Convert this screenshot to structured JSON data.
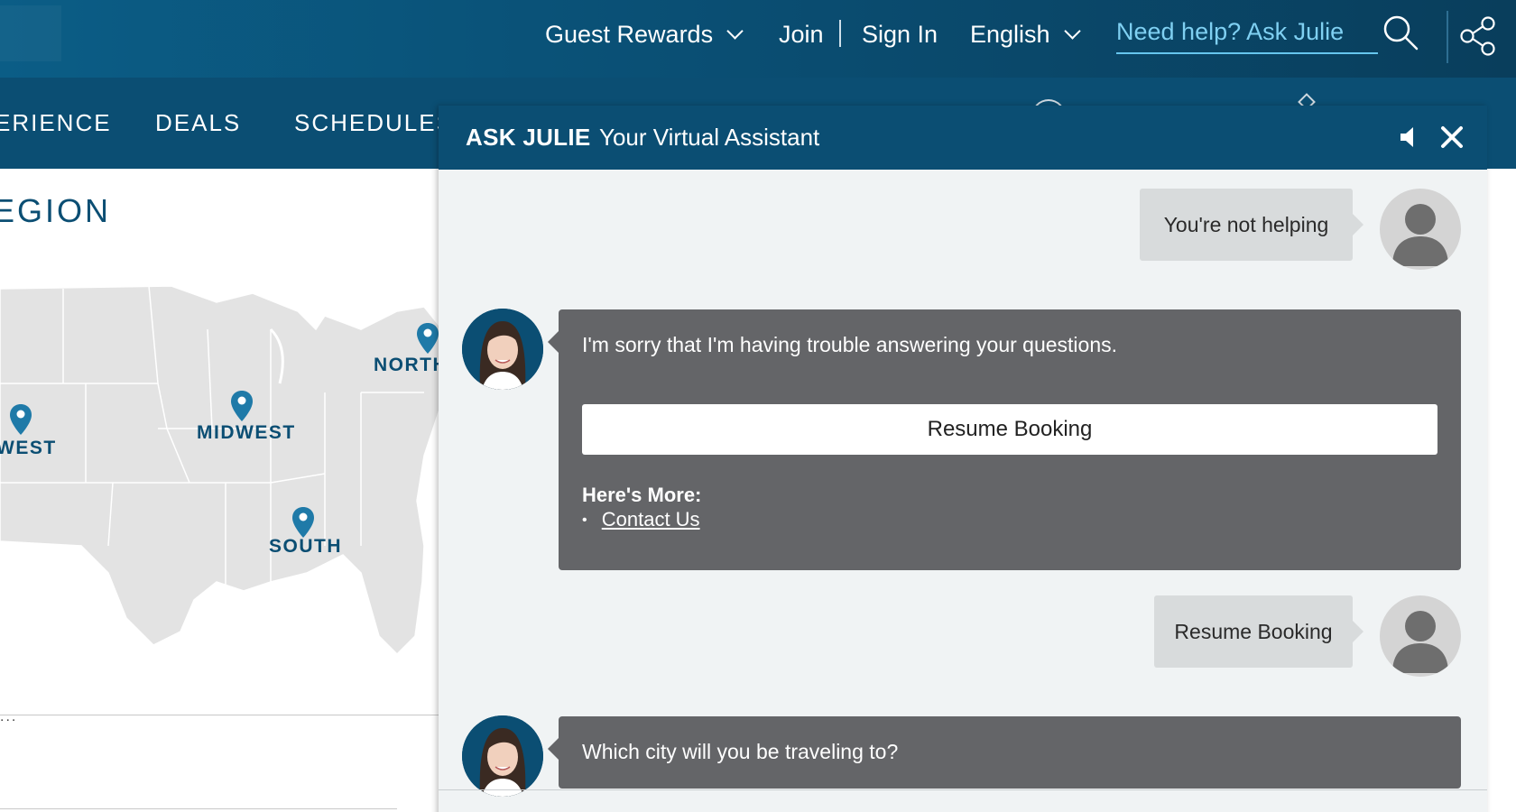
{
  "topbar": {
    "guest_rewards": "Guest Rewards",
    "join": "Join",
    "sign_in": "Sign In",
    "language": "English",
    "help_placeholder": "Need help? Ask Julie",
    "icons": [
      "chevron-down-icon",
      "search-icon",
      "share-icon"
    ]
  },
  "mainnav": {
    "items": [
      "ERIENCE",
      "DEALS",
      "SCHEDULES"
    ]
  },
  "map_section": {
    "heading": "EGION",
    "regions": {
      "north": "NORTH",
      "midwest": "MIDWEST",
      "west": "WEST",
      "south": "SOUTH"
    },
    "ellipsis": "..."
  },
  "chat": {
    "title": "ASK JULIE",
    "subtitle": "Your Virtual Assistant",
    "icons": [
      "speaker-icon",
      "close-icon"
    ],
    "messages": [
      {
        "from": "user",
        "text": "You're not helping"
      },
      {
        "from": "bot",
        "text": "I'm sorry that I'm having trouble answering your questions.",
        "button": "Resume Booking",
        "more_heading": "Here's More:",
        "links": [
          "Contact Us"
        ]
      },
      {
        "from": "user",
        "text": "Resume Booking"
      },
      {
        "from": "bot",
        "text": "Which city will you be traveling to?"
      }
    ]
  },
  "colors": {
    "header_blue": "#0b4e73",
    "help_text": "#7fd0f2",
    "bot_bubble": "#646568",
    "user_bubble": "#d8dbdc",
    "pin": "#1f7aa8"
  }
}
